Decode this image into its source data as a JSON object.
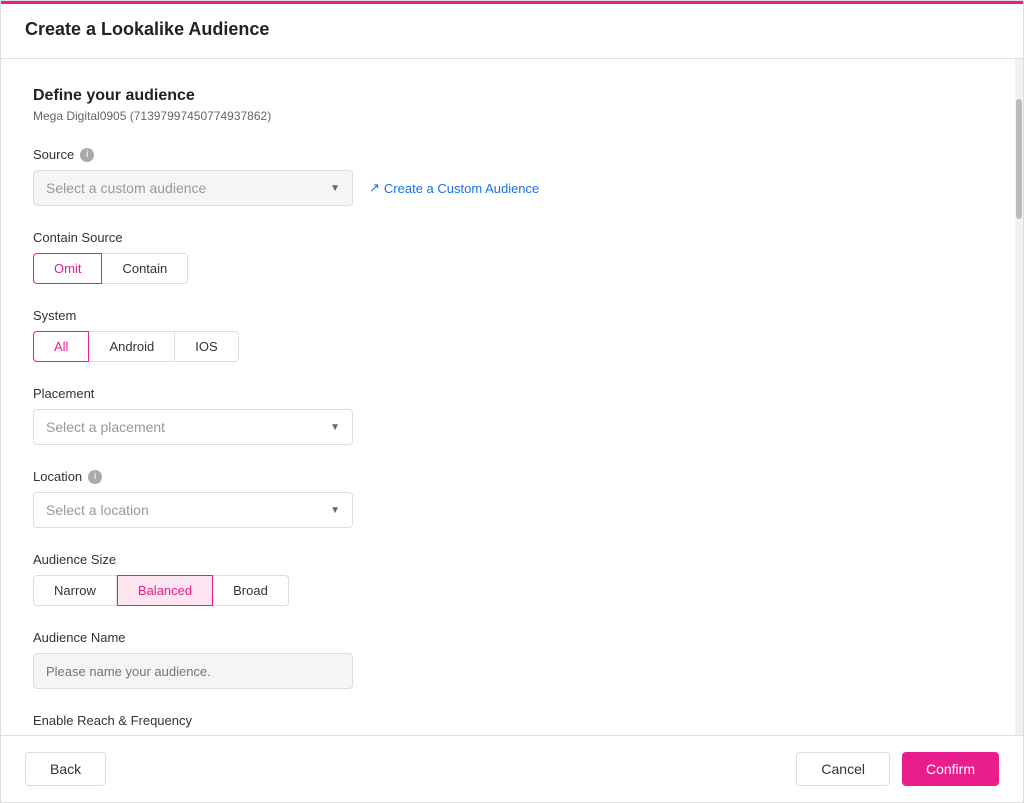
{
  "modal": {
    "title": "Create a Lookalike Audience",
    "red_border_color": "#e91e8c"
  },
  "define_audience": {
    "heading": "Define your audience",
    "subtitle": "Mega Digital0905 (71397997450774937862)"
  },
  "source_section": {
    "label": "Source",
    "dropdown_placeholder": "Select a custom audience",
    "create_link_text": "Create a Custom Audience",
    "create_link_icon": "↗"
  },
  "contain_source_section": {
    "label": "Contain Source",
    "buttons": [
      {
        "id": "omit",
        "label": "Omit",
        "active": true
      },
      {
        "id": "contain",
        "label": "Contain",
        "active": false
      }
    ]
  },
  "system_section": {
    "label": "System",
    "buttons": [
      {
        "id": "all",
        "label": "All",
        "active": true
      },
      {
        "id": "android",
        "label": "Android",
        "active": false
      },
      {
        "id": "ios",
        "label": "IOS",
        "active": false
      }
    ]
  },
  "placement_section": {
    "label": "Placement",
    "dropdown_placeholder": "Select a placement"
  },
  "location_section": {
    "label": "Location",
    "has_info": true,
    "dropdown_placeholder": "Select a location"
  },
  "audience_size_section": {
    "label": "Audience Size",
    "buttons": [
      {
        "id": "narrow",
        "label": "Narrow",
        "active": false
      },
      {
        "id": "balanced",
        "label": "Balanced",
        "active": true
      },
      {
        "id": "broad",
        "label": "Broad",
        "active": false
      }
    ]
  },
  "audience_name_section": {
    "label": "Audience Name",
    "input_placeholder": "Please name your audience."
  },
  "reach_frequency_section": {
    "label": "Enable Reach & Frequency"
  },
  "footer": {
    "back_label": "Back",
    "cancel_label": "Cancel",
    "confirm_label": "Confirm"
  },
  "colors": {
    "accent": "#e91e8c",
    "active_bg": "#fce4f0",
    "link_blue": "#1a73e8"
  }
}
